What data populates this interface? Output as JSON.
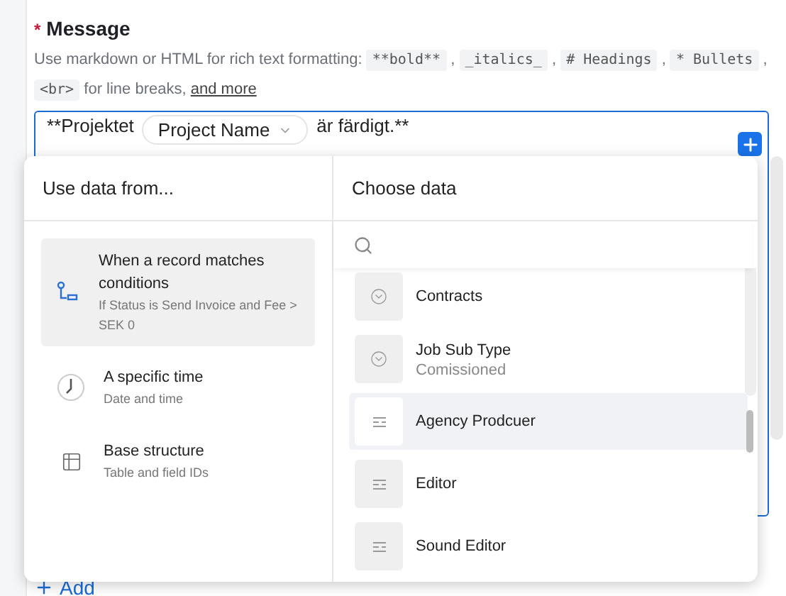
{
  "field": {
    "label": "Message",
    "required": true,
    "required_mark": "*",
    "help": "Use markdown or HTML for rich text formatting:",
    "help_codes": [
      "**bold**",
      "_italics_",
      "# Headings",
      "* Bullets"
    ],
    "separator": ",",
    "help_code2": "<br>",
    "help_tail": "for line breaks,",
    "help_link": "and more"
  },
  "editor": {
    "before": "**Projektet",
    "token": "Project Name",
    "after": "är färdigt.**"
  },
  "add_button": "Add",
  "popup": {
    "left_title": "Use data from...",
    "sources": [
      {
        "kind": "conditions",
        "title": "When a record matches conditions",
        "subtitle": "If Status is Send Invoice and Fee > SEK 0",
        "selected": true
      },
      {
        "kind": "time",
        "title": "A specific time",
        "subtitle": "Date and time",
        "selected": false
      },
      {
        "kind": "structure",
        "title": "Base structure",
        "subtitle": "Table and field IDs",
        "selected": false
      }
    ],
    "right_title": "Choose data",
    "fields": [
      {
        "kind": "select",
        "name": "Contracts",
        "selected": false
      },
      {
        "kind": "select",
        "name": "Job Sub Type",
        "value": "Comissioned",
        "selected": false
      },
      {
        "kind": "text",
        "name": "Agency Prodcuer",
        "selected": true
      },
      {
        "kind": "text",
        "name": "Editor",
        "selected": false
      },
      {
        "kind": "text",
        "name": "Sound Editor",
        "selected": false
      }
    ]
  }
}
